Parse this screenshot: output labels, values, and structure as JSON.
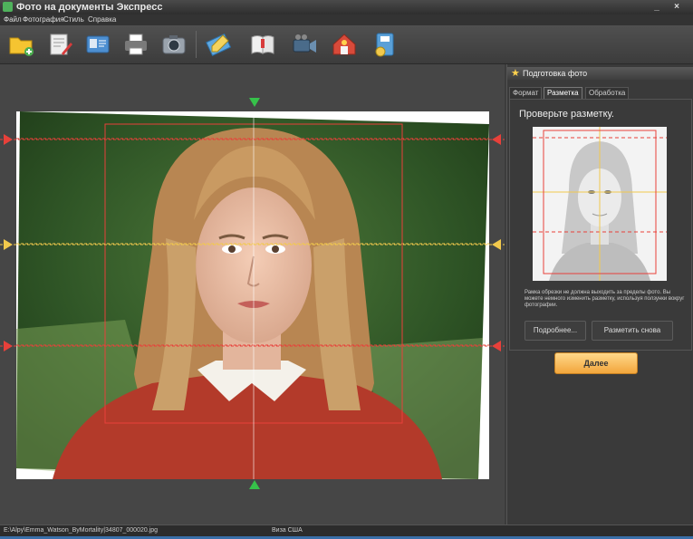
{
  "window": {
    "title": "Фото на документы Экспресс",
    "controls": {
      "minimize": "_",
      "close": "×"
    }
  },
  "menu": [
    "Файл",
    "Фотография",
    "Стиль",
    "Справка"
  ],
  "toolbar": {
    "icons": [
      "open-folder-icon",
      "edit-document-icon",
      "id-card-icon",
      "printer-icon",
      "camera-icon",
      "pencil-ruler-icon",
      "open-book-icon",
      "video-camera-icon",
      "home-help-icon",
      "save-disk-icon",
      "clock-timer-icon"
    ]
  },
  "sidebar": {
    "header": "Подготовка фото",
    "tabs": [
      "Формат",
      "Разметка",
      "Обработка"
    ],
    "active_tab": "Разметка",
    "heading": "Проверьте разметку.",
    "note": "Рамка обрезки не должна выходить за пределы фото. Вы можете немного изменить разметку, используя ползунки вокруг фотографии.",
    "buttons": {
      "details": "Подробнее...",
      "remark": "Разметить снова"
    },
    "next": "Далее"
  },
  "statusbar": {
    "path": "E:\\Alpy\\Emma_Watson_ByMortality|34807_000020.jpg",
    "format": "Виза США"
  },
  "colors": {
    "guide_red": "#e8403a",
    "guide_yellow": "#f2c94c",
    "handle_green": "#36c24a",
    "accent_orange": "#f2a63c"
  }
}
